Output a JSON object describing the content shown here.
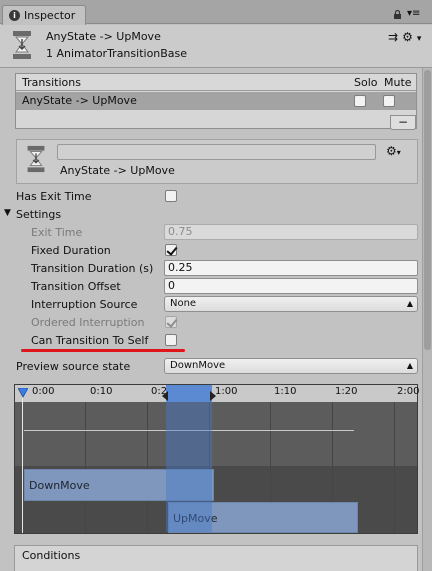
{
  "tab": {
    "title": "Inspector"
  },
  "header": {
    "name": "AnyState -> UpMove",
    "type": "1 AnimatorTransitionBase"
  },
  "transitions": {
    "title": "Transitions",
    "col_solo": "Solo",
    "col_mute": "Mute",
    "rows": [
      {
        "label": "AnyState -> UpMove",
        "solo": false,
        "mute": false
      }
    ],
    "remove_label": "−"
  },
  "transition": {
    "name_value": "",
    "name": "AnyState -> UpMove"
  },
  "props": {
    "has_exit_time": {
      "label": "Has Exit Time",
      "checked": false
    },
    "settings": {
      "label": "Settings",
      "expanded": true
    },
    "exit_time": {
      "label": "Exit Time",
      "value": "0.75"
    },
    "fixed_duration": {
      "label": "Fixed Duration",
      "checked": true
    },
    "transition_duration": {
      "label": "Transition Duration (s)",
      "value": "0.25"
    },
    "transition_offset": {
      "label": "Transition Offset",
      "value": "0"
    },
    "interruption_source": {
      "label": "Interruption Source",
      "value": "None"
    },
    "ordered_interruption": {
      "label": "Ordered Interruption",
      "checked": true
    },
    "can_transition_to_self": {
      "label": "Can Transition To Self",
      "checked": false
    },
    "preview_source_state": {
      "label": "Preview source state",
      "value": "DownMove"
    }
  },
  "timeline": {
    "ticks": [
      "0:00",
      "0:10",
      "0:20",
      "1:00",
      "1:10",
      "1:20",
      "2:00"
    ],
    "source_clip": "DownMove",
    "dest_clip": "UpMove"
  },
  "conditions": {
    "title": "Conditions"
  },
  "colors": {
    "highlight": "#e0151b",
    "selection": "#5b8ad3",
    "clip": "#7f97bc"
  }
}
